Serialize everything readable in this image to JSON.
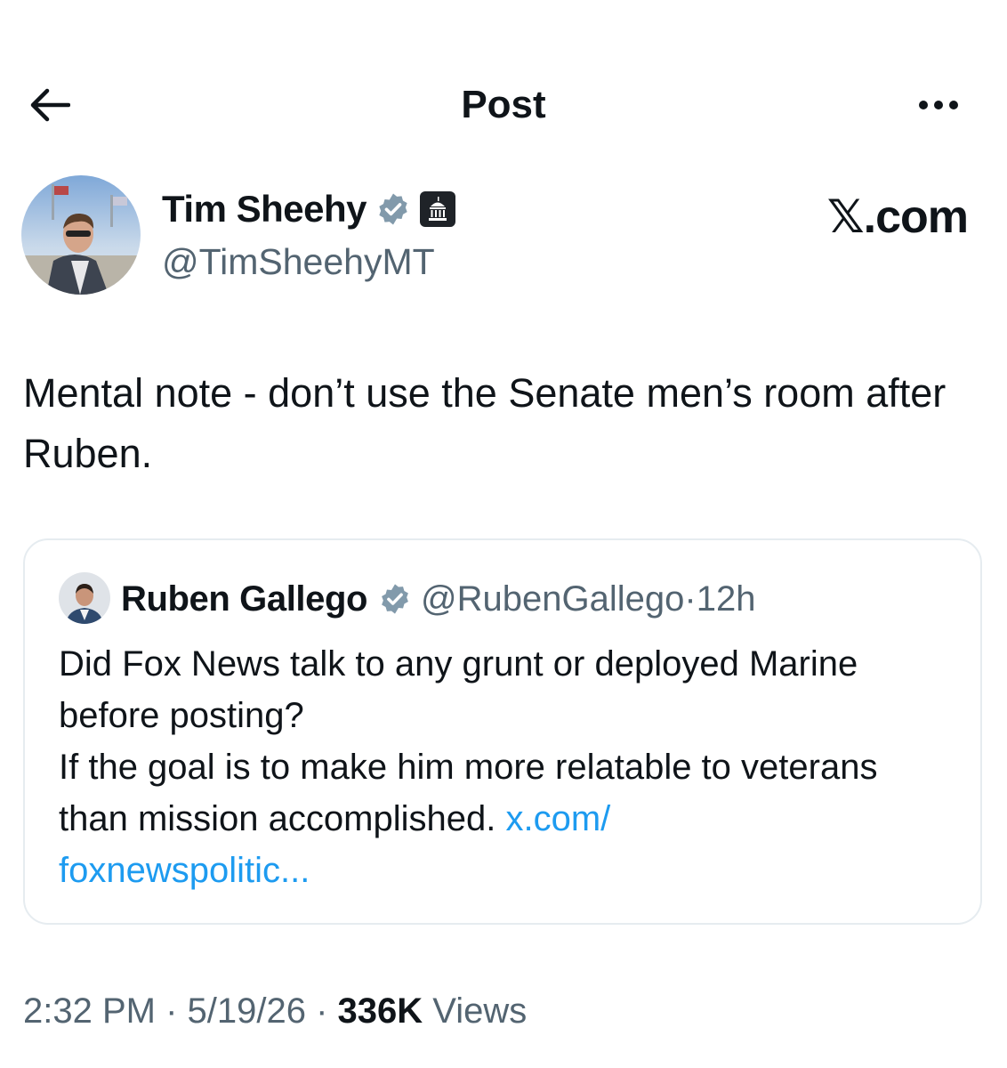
{
  "header": {
    "title": "Post",
    "back_icon": "arrow-left-icon",
    "more_icon": "more-horizontal-icon"
  },
  "author": {
    "name": "Tim Sheehy",
    "handle": "@TimSheehyMT",
    "verified_icon": "verified-badge-icon",
    "government_icon": "government-building-icon"
  },
  "watermark": "𝕏.com",
  "post": {
    "text": "Mental note - don’t use the Senate men’s room after Ruben."
  },
  "quote": {
    "name": "Ruben Gallego",
    "handle": "@RubenGallego",
    "separator": " · ",
    "time": "12h",
    "text": "Did Fox News talk to any grunt or deployed Marine before posting?\nIf the goal is to make him more relatable to veterans than mission accomplished. ",
    "link": "x.com/\nfoxnewspolitic..."
  },
  "meta": {
    "time": "2:32 PM",
    "separator": " · ",
    "date": "5/19/26",
    "views_count": "336K",
    "views_label": " Views"
  },
  "colors": {
    "text": "#0f1419",
    "secondary": "#536471",
    "link": "#1d9bf0",
    "verified": "#829aab",
    "border": "#e6ecf0"
  }
}
